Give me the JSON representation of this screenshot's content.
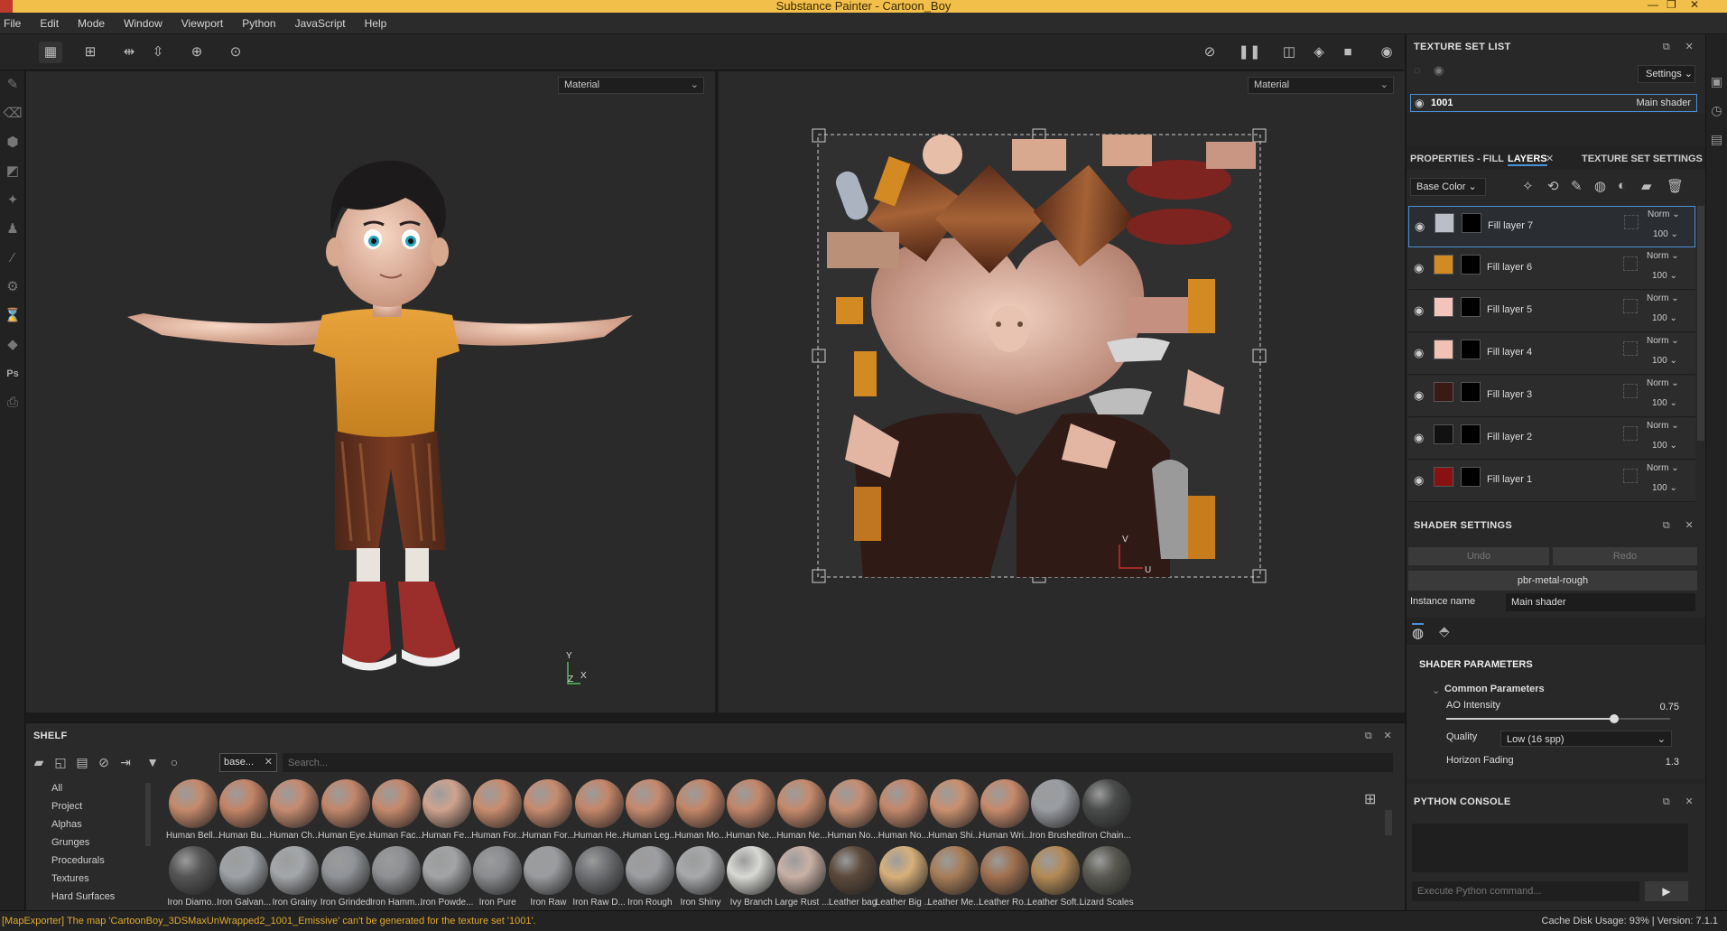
{
  "window": {
    "title": "Substance Painter - Cartoon_Boy"
  },
  "menu": [
    "File",
    "Edit",
    "Mode",
    "Window",
    "Viewport",
    "Python",
    "JavaScript",
    "Help"
  ],
  "viewport3d": {
    "channel_select": "Material"
  },
  "viewport2d": {
    "channel_select": "Material"
  },
  "texture_set_list": {
    "title": "TEXTURE SET LIST",
    "settings_label": "Settings",
    "set_name": "1001",
    "set_shader": "Main shader"
  },
  "tabs": {
    "properties": "PROPERTIES - FILL",
    "layers": "LAYERS",
    "tss": "TEXTURE SET SETTINGS"
  },
  "layers_panel": {
    "channel": "Base Color",
    "layers": [
      {
        "name": "Fill layer 7",
        "blend": "Norm",
        "opacity": "100",
        "color": "#b9bec7"
      },
      {
        "name": "Fill layer 6",
        "blend": "Norm",
        "opacity": "100",
        "color": "#d48a23"
      },
      {
        "name": "Fill layer 5",
        "blend": "Norm",
        "opacity": "100",
        "color": "#f3c4bc"
      },
      {
        "name": "Fill layer 4",
        "blend": "Norm",
        "opacity": "100",
        "color": "#f1c1b6"
      },
      {
        "name": "Fill layer 3",
        "blend": "Norm",
        "opacity": "100",
        "color": "#3a1a14"
      },
      {
        "name": "Fill layer 2",
        "blend": "Norm",
        "opacity": "100",
        "color": "#111111"
      },
      {
        "name": "Fill layer 1",
        "blend": "Norm",
        "opacity": "100",
        "color": "#8a1111"
      }
    ]
  },
  "shader_settings": {
    "title": "SHADER SETTINGS",
    "undo": "Undo",
    "redo": "Redo",
    "shader": "pbr-metal-rough",
    "instance_label": "Instance name",
    "instance_value": "Main shader",
    "params_title": "SHADER PARAMETERS",
    "common": "Common Parameters",
    "ao_label": "AO Intensity",
    "ao_value": "0.75",
    "quality_label": "Quality",
    "quality_value": "Low (16 spp)",
    "horizon_label": "Horizon Fading",
    "horizon_value": "1.3"
  },
  "python_console": {
    "title": "PYTHON CONSOLE",
    "placeholder": "Execute Python command..."
  },
  "shelf": {
    "title": "SHELF",
    "tag": "base...",
    "search_placeholder": "Search...",
    "categories": [
      "All",
      "Project",
      "Alphas",
      "Grunges",
      "Procedurals",
      "Textures",
      "Hard Surfaces"
    ],
    "row1": [
      "Human Bell...",
      "Human Bu...",
      "Human Ch...",
      "Human Eye...",
      "Human Fac...",
      "Human Fe...",
      "Human For...",
      "Human For...",
      "Human He...",
      "Human Leg...",
      "Human Mo...",
      "Human Ne...",
      "Human Ne...",
      "Human No...",
      "Human No...",
      "Human Shi...",
      "Human Wri...",
      "Iron Brushed",
      "Iron Chain..."
    ],
    "row2": [
      "Iron Diamo...",
      "Iron Galvan...",
      "Iron Grainy",
      "Iron Grinded",
      "Iron Hamm...",
      "Iron Powde...",
      "Iron Pure",
      "Iron Raw",
      "Iron Raw D...",
      "Iron Rough",
      "Iron Shiny",
      "Ivy Branch",
      "Large Rust ...",
      "Leather bag",
      "Leather Big ...",
      "Leather Me...",
      "Leather Ro...",
      "Leather Soft...",
      "Lizard Scales"
    ]
  },
  "status": {
    "message": "[MapExporter] The map 'CartoonBoy_3DSMaxUnWrapped2_1001_Emissive' can't be generated for the texture set '1001'.",
    "info": "Cache Disk Usage:  93% | Version: 7.1.1"
  },
  "axes": {
    "y": "Y",
    "z": "Z",
    "x": "X",
    "u": "U",
    "v": "V"
  }
}
